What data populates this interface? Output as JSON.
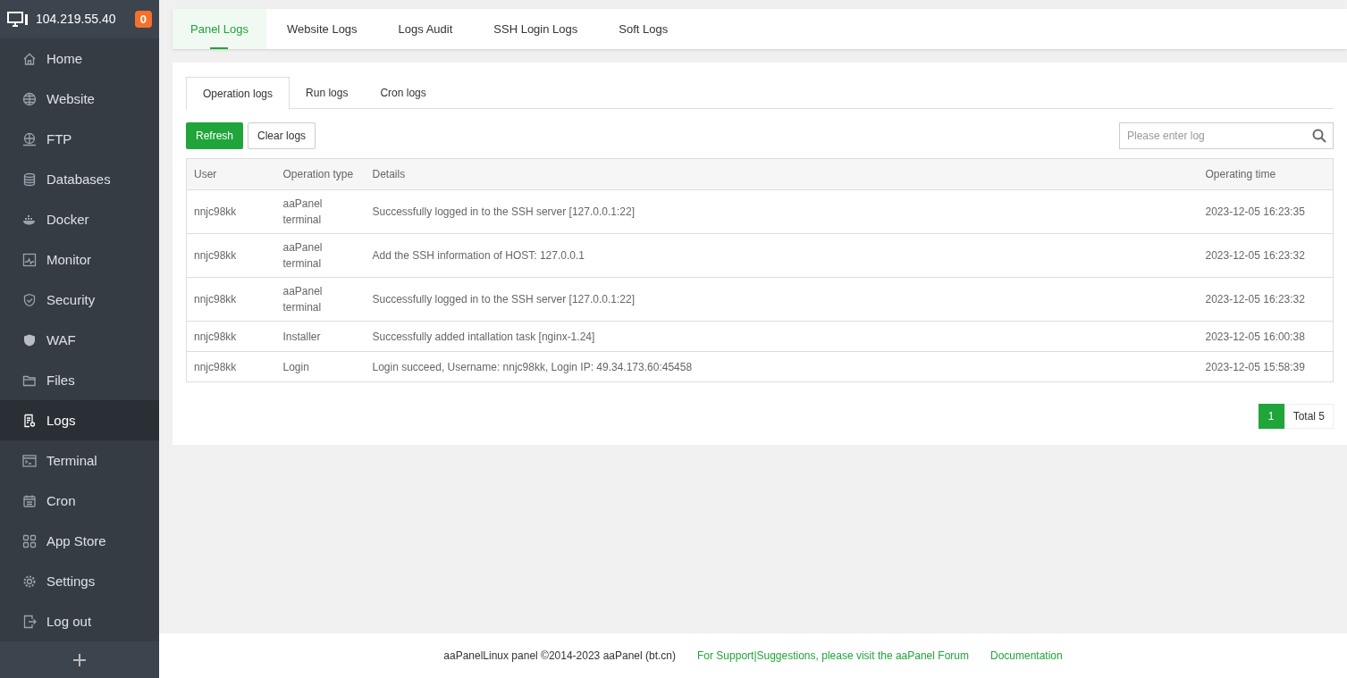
{
  "sidebar": {
    "server": "104.219.55.40",
    "badge": "0",
    "items": [
      {
        "label": "Home",
        "selected": false
      },
      {
        "label": "Website",
        "selected": false
      },
      {
        "label": "FTP",
        "selected": false
      },
      {
        "label": "Databases",
        "selected": false
      },
      {
        "label": "Docker",
        "selected": false
      },
      {
        "label": "Monitor",
        "selected": false
      },
      {
        "label": "Security",
        "selected": false
      },
      {
        "label": "WAF",
        "selected": false
      },
      {
        "label": "Files",
        "selected": false
      },
      {
        "label": "Logs",
        "selected": true
      },
      {
        "label": "Terminal",
        "selected": false
      },
      {
        "label": "Cron",
        "selected": false
      },
      {
        "label": "App Store",
        "selected": false
      },
      {
        "label": "Settings",
        "selected": false
      },
      {
        "label": "Log out",
        "selected": false
      }
    ]
  },
  "top_tabs": [
    {
      "label": "Panel Logs",
      "selected": true
    },
    {
      "label": "Website Logs",
      "selected": false
    },
    {
      "label": "Logs Audit",
      "selected": false
    },
    {
      "label": "SSH Login Logs",
      "selected": false
    },
    {
      "label": "Soft Logs",
      "selected": false
    }
  ],
  "sub_tabs": [
    {
      "label": "Operation logs",
      "selected": true
    },
    {
      "label": "Run logs",
      "selected": false
    },
    {
      "label": "Cron logs",
      "selected": false
    }
  ],
  "buttons": [
    "Refresh",
    "Clear logs"
  ],
  "search": {
    "placeholder": "Please enter log"
  },
  "table": {
    "columns": [
      "User",
      "Operation type",
      "Details",
      "Operating time"
    ],
    "rows": [
      [
        "nnjc98kk",
        "aaPanel terminal",
        "Successfully logged in to the SSH server [127.0.0.1:22]",
        "2023-12-05 16:23:35"
      ],
      [
        "nnjc98kk",
        "aaPanel terminal",
        "Add the SSH information of HOST: 127.0.0.1",
        "2023-12-05 16:23:32"
      ],
      [
        "nnjc98kk",
        "aaPanel terminal",
        "Successfully logged in to the SSH server [127.0.0.1:22]",
        "2023-12-05 16:23:32"
      ],
      [
        "nnjc98kk",
        "Installer",
        "Successfully added intallation task [nginx-1.24]",
        "2023-12-05 16:00:38"
      ],
      [
        "nnjc98kk",
        "Login",
        "Login succeed, Username: nnjc98kk, Login IP: 49.34.173.60:45458",
        "2023-12-05 15:58:39"
      ]
    ]
  },
  "pagination": {
    "pages": [
      {
        "label": "1",
        "selected": true
      }
    ],
    "total": "Total 5"
  },
  "footer": {
    "copyright": "aaPanelLinux panel ©2014-2023 aaPanel (bt.cn)",
    "links": [
      "For Support|Suggestions, please visit the aaPanel Forum",
      "Documentation"
    ]
  }
}
